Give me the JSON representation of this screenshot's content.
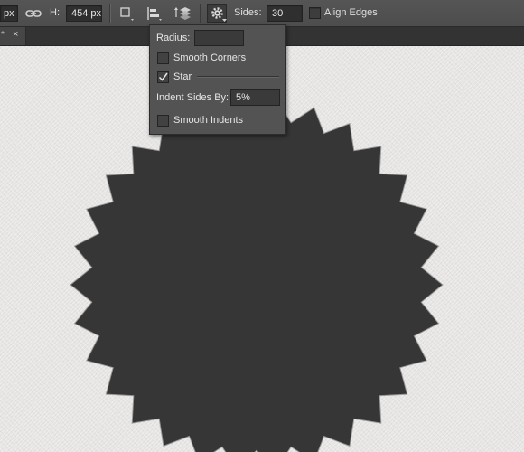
{
  "options_bar": {
    "width_unit": "px",
    "height_label": "H:",
    "height_value": "454 px",
    "sides_label": "Sides:",
    "sides_value": "30",
    "align_edges_label": "Align Edges",
    "align_edges_checked": false
  },
  "tab": {
    "name": "*",
    "close_glyph": "×"
  },
  "shape_options": {
    "radius_label": "Radius:",
    "radius_value": "",
    "smooth_corners_label": "Smooth Corners",
    "smooth_corners_checked": false,
    "star_label": "Star",
    "star_checked": true,
    "indent_label": "Indent Sides By:",
    "indent_value": "5%",
    "smooth_indents_label": "Smooth Indents",
    "smooth_indents_checked": false
  },
  "shape": {
    "points": 30,
    "indent_percent": 5,
    "fill": "#363636",
    "stroke": "#9a9a9a"
  },
  "colors": {
    "toolbar_bg": "#505050",
    "canvas_bg": "#e6e5e4",
    "dropdown_bg": "#535353"
  }
}
